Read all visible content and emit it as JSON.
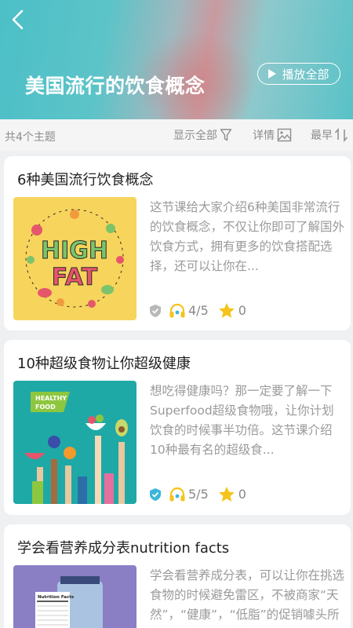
{
  "header": {
    "title": "美国流行的饮食概念",
    "play_all_label": "播放全部"
  },
  "filter_bar": {
    "topic_count": "共4个主题",
    "show_all_label": "显示全部",
    "details_label": "详情",
    "earliest_label": "最早"
  },
  "cards": [
    {
      "title": "6种美国流行饮食概念",
      "description": "这节课给大家介绍6种美国非常流行的饮食概念，不仅让你即可了解国外饮食方式，拥有更多的饮食搭配选择，还可以让你在...",
      "rating": "4/5",
      "stars": "0",
      "thumbnail_text_line1": "HIGH",
      "thumbnail_text_line2": "FAT",
      "badge_color": "#b8b8b8"
    },
    {
      "title": "10种超级食物让你超级健康",
      "description": "想吃得健康吗？那一定要了解一下Superfood超级食物哦，让你计划饮食的时候事半功倍。这节课介绍10种最有名的超级食...",
      "rating": "5/5",
      "stars": "0",
      "thumbnail_text_line1": "HEALTHY",
      "thumbnail_text_line2": "FOOD",
      "badge_color": "#3bb6d9"
    },
    {
      "title": "学会看营养成分表nutrition facts",
      "description": "学会看营养成分表，可以让你在挑选食物的时候避免雷区，不被商家“天然”，“健康”，“低脂”的促销噱头所蒙蔽，吃得更加健",
      "thumbnail_text_line1": "Nutrition Facts"
    }
  ],
  "colors": {
    "accent_teal": "#4cbfc7",
    "star": "#f6c31b",
    "headphones": "#f6c31b"
  }
}
